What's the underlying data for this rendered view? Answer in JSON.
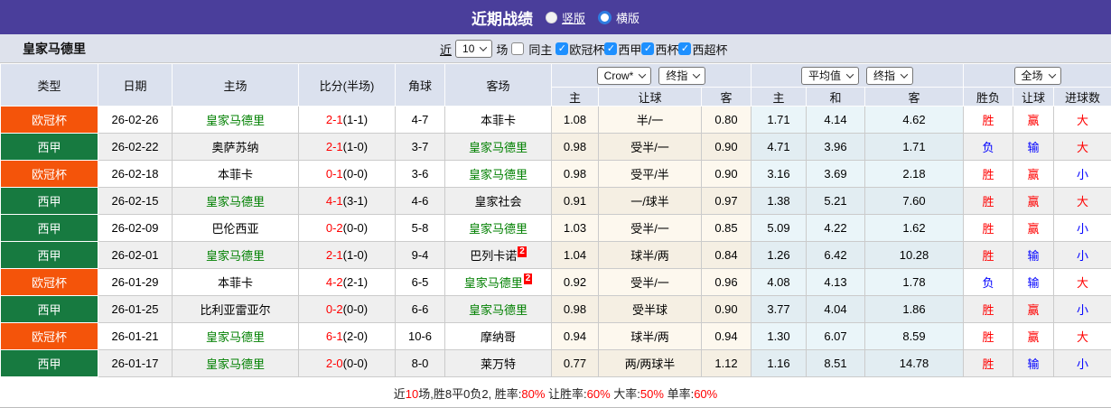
{
  "colors": {
    "accent_purple": "#4a3e9b",
    "league_colors": {
      "欧冠杯": "#f4540a",
      "西甲": "#177a40"
    },
    "subject_green": "#008000",
    "score_red": "#ff0000",
    "win_red": "#ff0000",
    "lose_blue": "#0000ff",
    "checkbox_blue": "#1e90ff",
    "asia_odds_bg": "#fdf8ee",
    "euro_odds_bg": "#eaf5f9"
  },
  "topbar": {
    "title": "近期战绩",
    "views": [
      {
        "label": "竖版",
        "selected": false
      },
      {
        "label": "横版",
        "selected": true
      }
    ]
  },
  "filterbar": {
    "team": "皇家马德里",
    "near": "近",
    "count": "10",
    "unit": "场",
    "same_home": "同主",
    "leagues": [
      "欧冠杯",
      "西甲",
      "西杯",
      "西超杯"
    ]
  },
  "table": {
    "headers": {
      "type": "类型",
      "date": "日期",
      "home": "主场",
      "score": "比分(半场)",
      "corner": "角球",
      "away": "客场",
      "asia_home": "主",
      "asia_handicap": "让球",
      "asia_away": "客",
      "euro_home": "主",
      "euro_draw": "和",
      "euro_away": "客",
      "result_wl": "胜负",
      "result_handicap": "让球",
      "result_goals": "进球数"
    },
    "dropdowns": {
      "asia": [
        "Crow*",
        "终指"
      ],
      "euro": [
        "平均值",
        "终指"
      ],
      "result": [
        "全场"
      ]
    },
    "rows": [
      {
        "league": "欧冠杯",
        "date": "26-02-26",
        "home": "皇家马德里",
        "home_subject": true,
        "home_badge": "",
        "ft": "2-1",
        "ht": "(1-1)",
        "corners": "4-7",
        "away": "本菲卡",
        "away_subject": false,
        "away_badge": "",
        "asia": [
          "1.08",
          "半/一",
          "0.80"
        ],
        "euro": [
          "1.71",
          "4.14",
          "4.62"
        ],
        "results": [
          [
            "胜",
            "r"
          ],
          [
            "赢",
            "r"
          ],
          [
            "大",
            "r"
          ]
        ]
      },
      {
        "league": "西甲",
        "date": "26-02-22",
        "home": "奥萨苏纳",
        "home_subject": false,
        "home_badge": "",
        "ft": "2-1",
        "ht": "(1-0)",
        "corners": "3-7",
        "away": "皇家马德里",
        "away_subject": true,
        "away_badge": "",
        "asia": [
          "0.98",
          "受半/一",
          "0.90"
        ],
        "euro": [
          "4.71",
          "3.96",
          "1.71"
        ],
        "results": [
          [
            "负",
            "b"
          ],
          [
            "输",
            "b"
          ],
          [
            "大",
            "r"
          ]
        ]
      },
      {
        "league": "欧冠杯",
        "date": "26-02-18",
        "home": "本菲卡",
        "home_subject": false,
        "home_badge": "",
        "ft": "0-1",
        "ht": "(0-0)",
        "corners": "3-6",
        "away": "皇家马德里",
        "away_subject": true,
        "away_badge": "",
        "asia": [
          "0.98",
          "受平/半",
          "0.90"
        ],
        "euro": [
          "3.16",
          "3.69",
          "2.18"
        ],
        "results": [
          [
            "胜",
            "r"
          ],
          [
            "赢",
            "r"
          ],
          [
            "小",
            "b"
          ]
        ]
      },
      {
        "league": "西甲",
        "date": "26-02-15",
        "home": "皇家马德里",
        "home_subject": true,
        "home_badge": "",
        "ft": "4-1",
        "ht": "(3-1)",
        "corners": "4-6",
        "away": "皇家社会",
        "away_subject": false,
        "away_badge": "",
        "asia": [
          "0.91",
          "一/球半",
          "0.97"
        ],
        "euro": [
          "1.38",
          "5.21",
          "7.60"
        ],
        "results": [
          [
            "胜",
            "r"
          ],
          [
            "赢",
            "r"
          ],
          [
            "大",
            "r"
          ]
        ]
      },
      {
        "league": "西甲",
        "date": "26-02-09",
        "home": "巴伦西亚",
        "home_subject": false,
        "home_badge": "",
        "ft": "0-2",
        "ht": "(0-0)",
        "corners": "5-8",
        "away": "皇家马德里",
        "away_subject": true,
        "away_badge": "",
        "asia": [
          "1.03",
          "受半/一",
          "0.85"
        ],
        "euro": [
          "5.09",
          "4.22",
          "1.62"
        ],
        "results": [
          [
            "胜",
            "r"
          ],
          [
            "赢",
            "r"
          ],
          [
            "小",
            "b"
          ]
        ]
      },
      {
        "league": "西甲",
        "date": "26-02-01",
        "home": "皇家马德里",
        "home_subject": true,
        "home_badge": "",
        "ft": "2-1",
        "ht": "(1-0)",
        "corners": "9-4",
        "away": "巴列卡诺",
        "away_subject": false,
        "away_badge": "2",
        "asia": [
          "1.04",
          "球半/两",
          "0.84"
        ],
        "euro": [
          "1.26",
          "6.42",
          "10.28"
        ],
        "results": [
          [
            "胜",
            "r"
          ],
          [
            "输",
            "b"
          ],
          [
            "小",
            "b"
          ]
        ]
      },
      {
        "league": "欧冠杯",
        "date": "26-01-29",
        "home": "本菲卡",
        "home_subject": false,
        "home_badge": "",
        "ft": "4-2",
        "ht": "(2-1)",
        "corners": "6-5",
        "away": "皇家马德里",
        "away_subject": true,
        "away_badge": "2",
        "asia": [
          "0.92",
          "受半/一",
          "0.96"
        ],
        "euro": [
          "4.08",
          "4.13",
          "1.78"
        ],
        "results": [
          [
            "负",
            "b"
          ],
          [
            "输",
            "b"
          ],
          [
            "大",
            "r"
          ]
        ]
      },
      {
        "league": "西甲",
        "date": "26-01-25",
        "home": "比利亚雷亚尔",
        "home_subject": false,
        "home_badge": "",
        "ft": "0-2",
        "ht": "(0-0)",
        "corners": "6-6",
        "away": "皇家马德里",
        "away_subject": true,
        "away_badge": "",
        "asia": [
          "0.98",
          "受半球",
          "0.90"
        ],
        "euro": [
          "3.77",
          "4.04",
          "1.86"
        ],
        "results": [
          [
            "胜",
            "r"
          ],
          [
            "赢",
            "r"
          ],
          [
            "小",
            "b"
          ]
        ]
      },
      {
        "league": "欧冠杯",
        "date": "26-01-21",
        "home": "皇家马德里",
        "home_subject": true,
        "home_badge": "",
        "ft": "6-1",
        "ht": "(2-0)",
        "corners": "10-6",
        "away": "摩纳哥",
        "away_subject": false,
        "away_badge": "",
        "asia": [
          "0.94",
          "球半/两",
          "0.94"
        ],
        "euro": [
          "1.30",
          "6.07",
          "8.59"
        ],
        "results": [
          [
            "胜",
            "r"
          ],
          [
            "赢",
            "r"
          ],
          [
            "大",
            "r"
          ]
        ]
      },
      {
        "league": "西甲",
        "date": "26-01-17",
        "home": "皇家马德里",
        "home_subject": true,
        "home_badge": "",
        "ft": "2-0",
        "ht": "(0-0)",
        "corners": "8-0",
        "away": "莱万特",
        "away_subject": false,
        "away_badge": "",
        "asia": [
          "0.77",
          "两/两球半",
          "1.12"
        ],
        "euro": [
          "1.16",
          "8.51",
          "14.78"
        ],
        "results": [
          [
            "胜",
            "r"
          ],
          [
            "输",
            "b"
          ],
          [
            "小",
            "b"
          ]
        ]
      }
    ]
  },
  "footer": {
    "segments": [
      [
        "近",
        "k"
      ],
      [
        "10",
        "r"
      ],
      [
        "场,胜8平0负2, 胜率:",
        "k"
      ],
      [
        "80%",
        "r"
      ],
      [
        " 让胜率:",
        "k"
      ],
      [
        "60%",
        "r"
      ],
      [
        " 大率:",
        "k"
      ],
      [
        "50%",
        "r"
      ],
      [
        " 单率:",
        "k"
      ],
      [
        "60%",
        "r"
      ]
    ]
  }
}
